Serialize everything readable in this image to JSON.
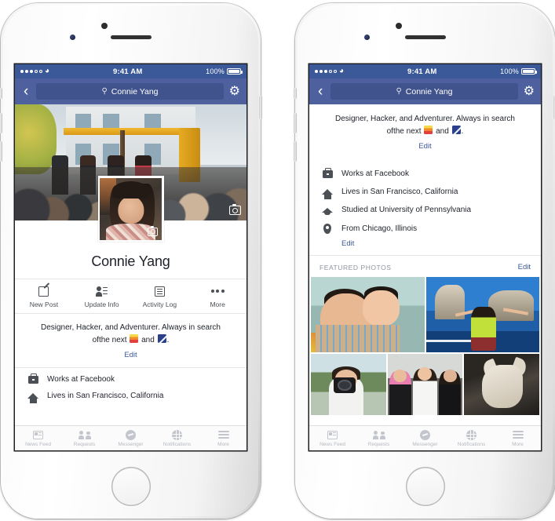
{
  "status_bar": {
    "time": "9:41 AM",
    "battery_percent": "100%",
    "signal_dots_filled": 3,
    "signal_dots_total": 5,
    "wifi_icon": "wifi-icon"
  },
  "nav_bar": {
    "back_icon": "chevron-left-icon",
    "search_icon": "search-icon",
    "search_value": "Connie Yang",
    "settings_icon": "gear-icon"
  },
  "profile": {
    "name": "Connie Yang",
    "cover_camera_icon": "camera-icon",
    "avatar_camera_icon": "camera-icon",
    "bio_line1": "Designer, Hacker, and Adventurer. Always in search",
    "bio_line2_pre": "ofthe next ",
    "bio_emoji_1": "sunset-emoji",
    "bio_line2_mid": " and ",
    "bio_emoji_2": "mountain-emoji",
    "bio_line2_post": ".",
    "edit_label": "Edit"
  },
  "actions": [
    {
      "label": "New Post",
      "icon": "compose-icon"
    },
    {
      "label": "Update Info",
      "icon": "person-edit-icon"
    },
    {
      "label": "Activity Log",
      "icon": "list-icon"
    },
    {
      "label": "More",
      "icon": "ellipsis-icon"
    }
  ],
  "info_rows": [
    {
      "text": "Works at Facebook",
      "icon": "briefcase-icon"
    },
    {
      "text": "Lives in San Francisco, California",
      "icon": "home-icon"
    },
    {
      "text": "Studied at University of Pennsylvania",
      "icon": "graduation-cap-icon"
    },
    {
      "text": "From Chicago, Illinois",
      "icon": "map-pin-icon"
    }
  ],
  "info_edit_label": "Edit",
  "featured": {
    "title": "FEATURED PHOTOS",
    "edit_label": "Edit",
    "photos": [
      {
        "alt": "man holding small child"
      },
      {
        "alt": "woman on sailboat near rock arches"
      },
      {
        "alt": "woman holding a camera outdoors"
      },
      {
        "alt": "three women posing together"
      },
      {
        "alt": "dog lying on dark background"
      }
    ]
  },
  "tab_bar": [
    {
      "label": "News Feed",
      "icon": "news-feed-icon"
    },
    {
      "label": "Requests",
      "icon": "friend-requests-icon"
    },
    {
      "label": "Messenger",
      "icon": "messenger-icon"
    },
    {
      "label": "Notifications",
      "icon": "globe-icon"
    },
    {
      "label": "More",
      "icon": "hamburger-icon"
    }
  ],
  "colors": {
    "facebook_blue": "#3b5998",
    "nav_blue": "#4e619e",
    "search_field": "#41538d",
    "link_blue": "#3b5998",
    "text_dark": "#1d2129",
    "text_gray": "#4b4f56",
    "tab_inactive": "#c3c7cd"
  }
}
